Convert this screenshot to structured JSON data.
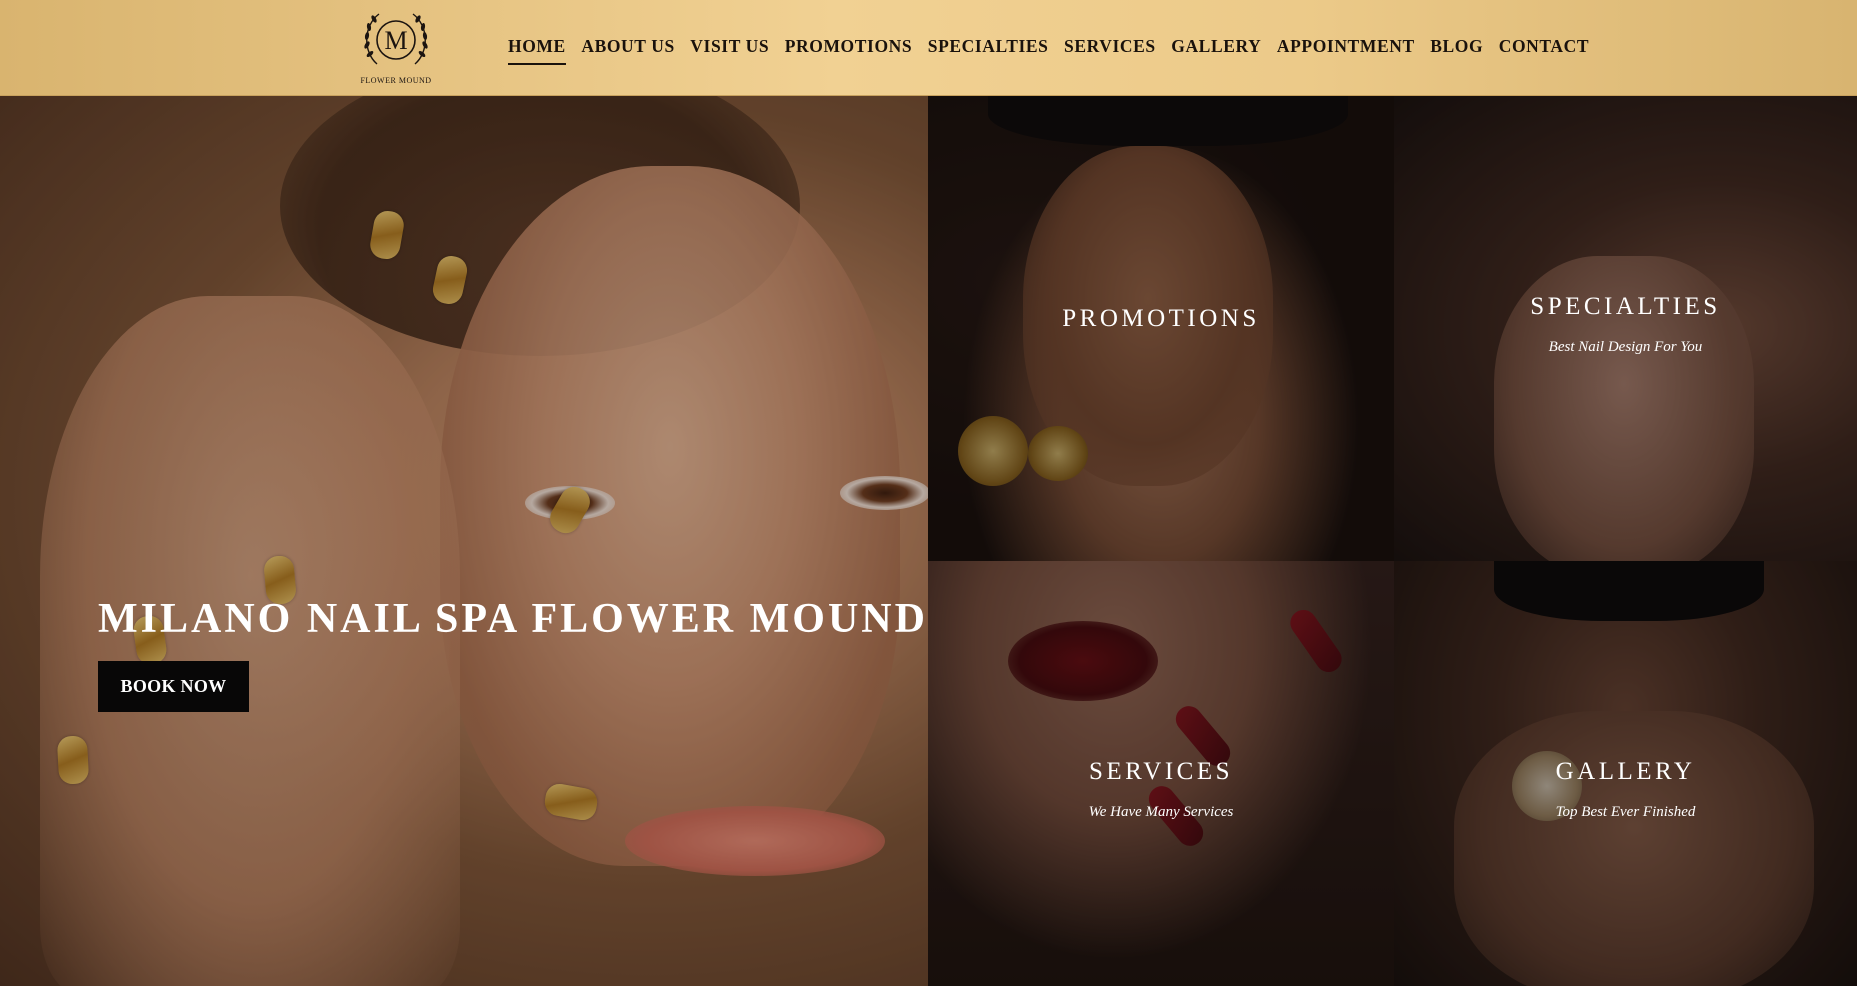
{
  "header": {
    "logo_letter": "M",
    "logo_subtext": "FLOWER MOUND",
    "nav": [
      {
        "label": "HOME",
        "active": true
      },
      {
        "label": "ABOUT US",
        "active": false
      },
      {
        "label": "VISIT US",
        "active": false
      },
      {
        "label": "PROMOTIONS",
        "active": false
      },
      {
        "label": "SPECIALTIES",
        "active": false
      },
      {
        "label": "SERVICES",
        "active": false
      },
      {
        "label": "GALLERY",
        "active": false
      },
      {
        "label": "APPOINTMENT",
        "active": false
      },
      {
        "label": "BLOG",
        "active": false
      },
      {
        "label": "CONTACT",
        "active": false
      }
    ]
  },
  "hero": {
    "title": "MILANO NAIL SPA FLOWER MOUND",
    "button_label": "BOOK NOW"
  },
  "tiles": {
    "promotions": {
      "title": "PROMOTIONS",
      "subtitle": ""
    },
    "specialties": {
      "title": "SPECIALTIES",
      "subtitle": "Best Nail Design For You"
    },
    "services": {
      "title": "SERVICES",
      "subtitle": "We Have Many Services"
    },
    "gallery": {
      "title": "GALLERY",
      "subtitle": "Top Best Ever Finished"
    }
  },
  "colors": {
    "header_gold": "#f1d193",
    "nav_text": "#1a120c",
    "button_bg": "#080707",
    "overlay_text": "#ffffff"
  }
}
